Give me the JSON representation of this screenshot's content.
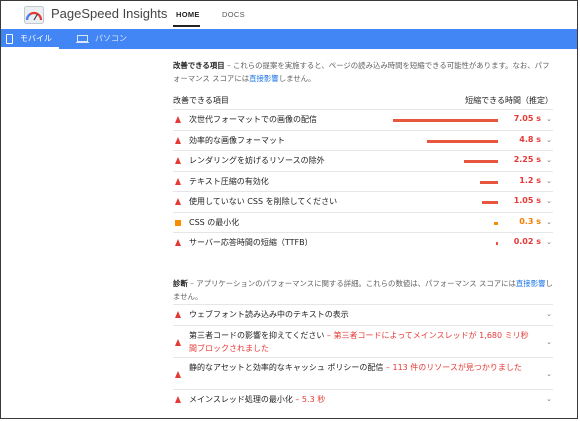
{
  "header": {
    "app_title": "PageSpeed Insights",
    "nav": {
      "home": "HOME",
      "docs": "DOCS"
    }
  },
  "tabs": {
    "mobile": "モバイル",
    "desktop": "パソコン",
    "active": "mobile"
  },
  "opportunities": {
    "heading": "改善できる項目",
    "description": " – これらの提案を実施すると、ページの読み込み時間を短縮できる可能性があります。なお、パフォーマンス スコアには",
    "link": "直接影響",
    "description_end": "しません。",
    "col_left": "改善できる項目",
    "col_right": "短縮できる時間（推定）",
    "items": [
      {
        "title": "次世代フォーマットでの画像の配信",
        "value": "7.05 s",
        "seconds": 7.05,
        "severity": "fail"
      },
      {
        "title": "効率的な画像フォーマット",
        "value": "4.8 s",
        "seconds": 4.8,
        "severity": "fail"
      },
      {
        "title": "レンダリングを妨げるリソースの除外",
        "value": "2.25 s",
        "seconds": 2.25,
        "severity": "fail"
      },
      {
        "title": "テキスト圧縮の有効化",
        "value": "1.2 s",
        "seconds": 1.2,
        "severity": "fail"
      },
      {
        "title": "使用していない CSS を削除してください",
        "value": "1.05 s",
        "seconds": 1.05,
        "severity": "fail"
      },
      {
        "title": "CSS の最小化",
        "value": "0.3 s",
        "seconds": 0.3,
        "severity": "average"
      },
      {
        "title": "サーバー応答時間の短縮（TTFB）",
        "value": "0.02 s",
        "seconds": 0.02,
        "severity": "fail"
      }
    ]
  },
  "diagnostics": {
    "heading": "診断",
    "description": " – アプリケーションのパフォーマンスに関する詳細。これらの数値は、パフォーマンス スコアには",
    "link": "直接影響",
    "description_end": "しません。",
    "items": [
      {
        "title": "ウェブフォント読み込み中のテキストの表示",
        "detail": ""
      },
      {
        "title": "第三者コードの影響を抑えてください",
        "detail": " – 第三者コードによってメインスレッドが 1,680 ミリ秒間ブロックされました"
      },
      {
        "title": "静的なアセットと効率的なキャッシュ ポリシーの配信",
        "detail": " – 113 件のリソースが見つかりました"
      },
      {
        "title": "メインスレッド処理の最小化",
        "detail": " – 5.3 秒"
      }
    ]
  },
  "colors": {
    "brand_blue": "#4285f4",
    "fail_red": "#e53935",
    "average_orange": "#fb8c00",
    "link_blue": "#1a73e8"
  }
}
